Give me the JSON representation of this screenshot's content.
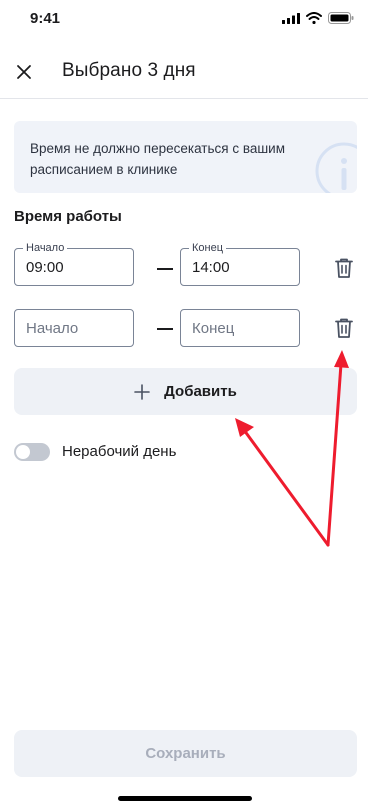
{
  "status_bar": {
    "time": "9:41"
  },
  "header": {
    "title": "Выбрано 3 дня"
  },
  "info_banner": {
    "text": "Время не должно пересекаться с вашим расписанием в клинике"
  },
  "work_time": {
    "title": "Время работы",
    "rows": [
      {
        "start_legend": "Начало",
        "start_value": "09:00",
        "end_legend": "Конец",
        "end_value": "14:00"
      },
      {
        "start_placeholder": "Начало",
        "end_placeholder": "Конец"
      }
    ]
  },
  "add_button": {
    "label": "Добавить"
  },
  "day_off": {
    "label": "Нерабочий день",
    "enabled": false
  },
  "save_button": {
    "label": "Сохранить"
  },
  "colors": {
    "accent_arrow": "#ee1c2e",
    "banner_bg": "#f0f3f9",
    "button_bg": "#eef1f6"
  }
}
